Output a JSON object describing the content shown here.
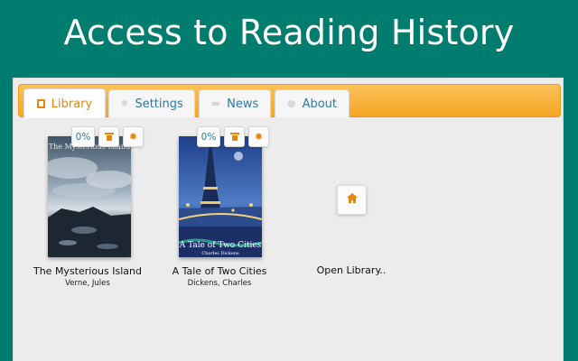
{
  "banner": {
    "title": "Access to Reading History"
  },
  "tabs": [
    {
      "label": "Library",
      "icon": "book-icon",
      "active": true
    },
    {
      "label": "Settings",
      "icon": "gear-icon",
      "active": false
    },
    {
      "label": "News",
      "icon": "news-icon",
      "active": false
    },
    {
      "label": "About",
      "icon": "info-icon",
      "active": false
    }
  ],
  "books": [
    {
      "title": "The Mysterious Island",
      "author": "Verne, Jules",
      "progress": "0%",
      "cover_text": "The Mysterious Island"
    },
    {
      "title": "A Tale of Two Cities",
      "author": "Dickens, Charles",
      "progress": "0%",
      "cover_text": "A Tale of Two Cities",
      "cover_subtext": "Charles Dickens"
    }
  ],
  "open_library": {
    "label": "Open Library..",
    "icon": "home-icon"
  },
  "colors": {
    "background": "#007d6e",
    "tab_bar": "#f6a623",
    "accent_orange": "#e8850c",
    "link_blue": "#2a7aa8"
  }
}
